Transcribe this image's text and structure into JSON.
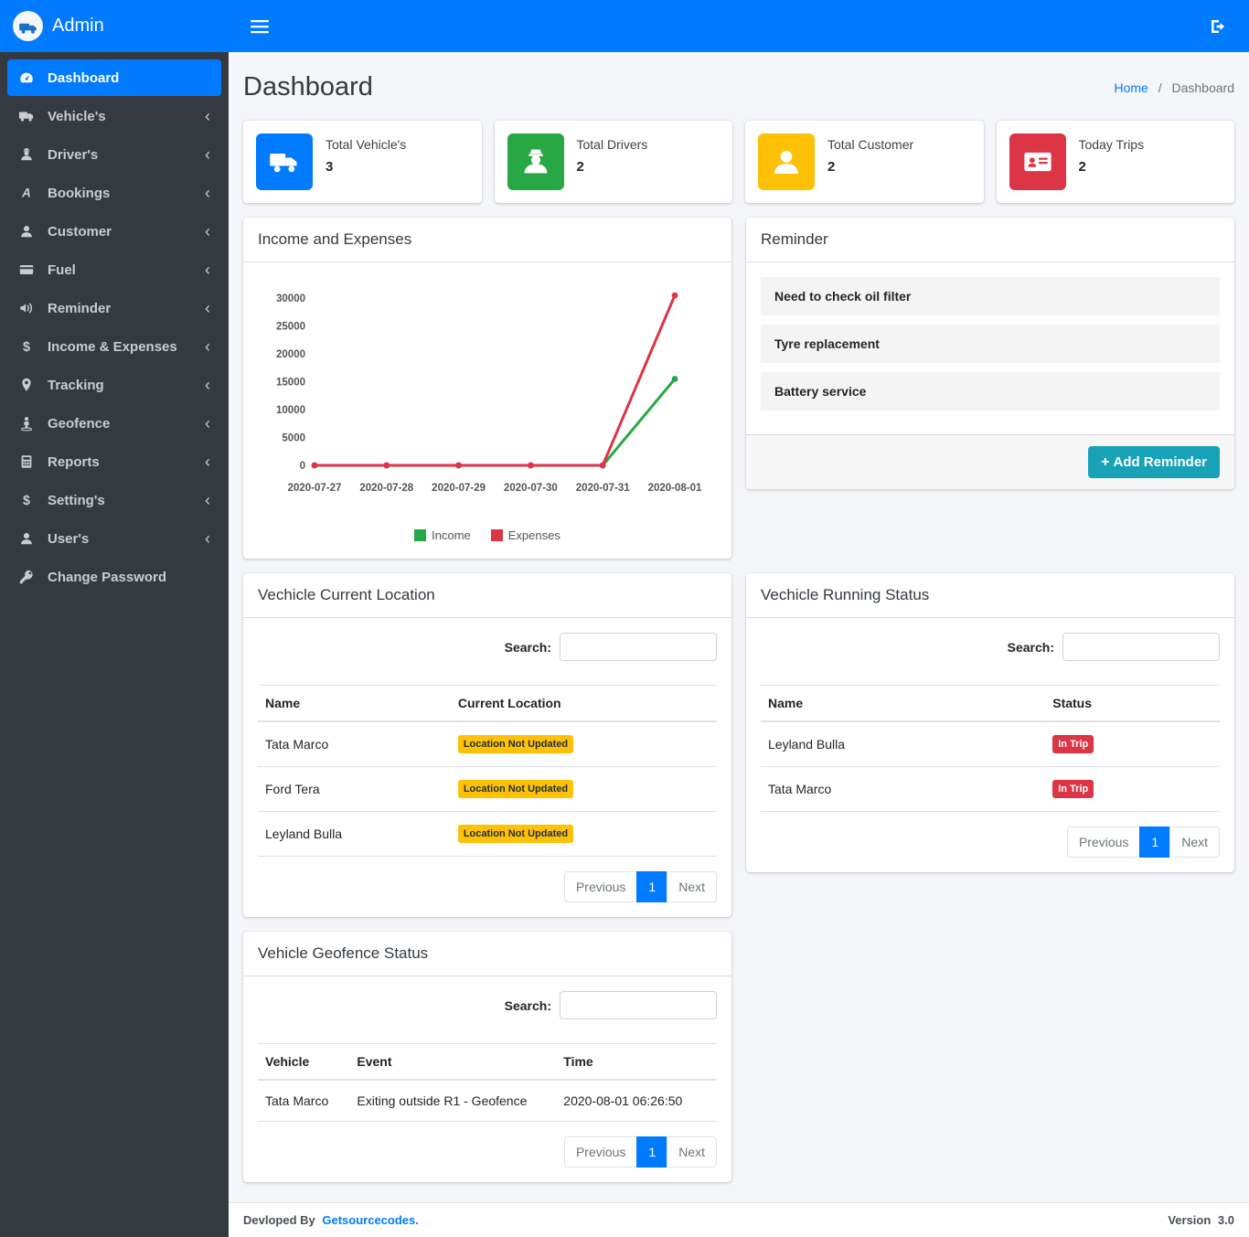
{
  "sidebar": {
    "brand": "Admin",
    "items": [
      {
        "label": "Dashboard",
        "icon": "tachometer-icon",
        "active": true,
        "chevron": false
      },
      {
        "label": "Vehicle's",
        "icon": "truck-icon",
        "active": false,
        "chevron": true
      },
      {
        "label": "Driver's",
        "icon": "driver-icon",
        "active": false,
        "chevron": true
      },
      {
        "label": "Bookings",
        "icon": "bookings-icon",
        "active": false,
        "chevron": true
      },
      {
        "label": "Customer",
        "icon": "user-icon",
        "active": false,
        "chevron": true
      },
      {
        "label": "Fuel",
        "icon": "fuel-card-icon",
        "active": false,
        "chevron": true
      },
      {
        "label": "Reminder",
        "icon": "bullhorn-icon",
        "active": false,
        "chevron": true
      },
      {
        "label": "Income & Expenses",
        "icon": "dollar-icon",
        "active": false,
        "chevron": true
      },
      {
        "label": "Tracking",
        "icon": "map-marker-icon",
        "active": false,
        "chevron": true
      },
      {
        "label": "Geofence",
        "icon": "street-view-icon",
        "active": false,
        "chevron": true
      },
      {
        "label": "Reports",
        "icon": "calculator-icon",
        "active": false,
        "chevron": true
      },
      {
        "label": "Setting's",
        "icon": "dollar-icon",
        "active": false,
        "chevron": true
      },
      {
        "label": "User's",
        "icon": "user-icon",
        "active": false,
        "chevron": true
      },
      {
        "label": "Change Password",
        "icon": "key-icon",
        "active": false,
        "chevron": false
      }
    ]
  },
  "page": {
    "title": "Dashboard",
    "breadcrumb_home": "Home",
    "breadcrumb_sep": "/",
    "breadcrumb_current": "Dashboard"
  },
  "stats": [
    {
      "label": "Total Vehicle's",
      "value": "3",
      "color": "#007bff",
      "icon": "truck-icon"
    },
    {
      "label": "Total Drivers",
      "value": "2",
      "color": "#28a745",
      "icon": "driver-icon"
    },
    {
      "label": "Total Customer",
      "value": "2",
      "color": "#ffc107",
      "icon": "user-icon"
    },
    {
      "label": "Today Trips",
      "value": "2",
      "color": "#dc3545",
      "icon": "id-card-icon"
    }
  ],
  "chart_card": {
    "title": "Income and Expenses"
  },
  "chart_data": {
    "type": "line",
    "x": [
      "2020-07-27",
      "2020-07-28",
      "2020-07-29",
      "2020-07-30",
      "2020-07-31",
      "2020-08-01"
    ],
    "series": [
      {
        "name": "Income",
        "color": "#28a745",
        "values": [
          0,
          0,
          0,
          0,
          0,
          15500
        ]
      },
      {
        "name": "Expenses",
        "color": "#dc3545",
        "values": [
          0,
          0,
          0,
          0,
          0,
          30500
        ]
      }
    ],
    "ylim": [
      0,
      30000
    ],
    "yticks": [
      0,
      5000,
      10000,
      15000,
      20000,
      25000,
      30000
    ],
    "legend_position": "bottom",
    "grid": false
  },
  "reminder": {
    "title": "Reminder",
    "items": [
      "Need to check oil filter",
      "Tyre replacement",
      "Battery service"
    ],
    "add_button": "Add Reminder",
    "add_button_color": "#17a2b8"
  },
  "current_location": {
    "title": "Vechicle Current Location",
    "search_label": "Search:",
    "search_value": "",
    "columns": [
      "Name",
      "Current Location"
    ],
    "rows": [
      {
        "name": "Tata Marco",
        "status": "Location Not Updated"
      },
      {
        "name": "Ford Tera",
        "status": "Location Not Updated"
      },
      {
        "name": "Leyland Bulla",
        "status": "Location Not Updated"
      }
    ],
    "pagination": {
      "prev": "Previous",
      "page": "1",
      "next": "Next"
    }
  },
  "running_status": {
    "title": "Vechicle Running Status",
    "search_label": "Search:",
    "search_value": "",
    "columns": [
      "Name",
      "Status"
    ],
    "rows": [
      {
        "name": "Leyland Bulla",
        "status": "In Trip"
      },
      {
        "name": "Tata Marco",
        "status": "In Trip"
      }
    ],
    "pagination": {
      "prev": "Previous",
      "page": "1",
      "next": "Next"
    }
  },
  "geofence_status": {
    "title": "Vehicle Geofence Status",
    "search_label": "Search:",
    "search_value": "",
    "columns": [
      "Vehicle",
      "Event",
      "Time"
    ],
    "rows": [
      {
        "vehicle": "Tata Marco",
        "event": "Exiting outside R1 - Geofence",
        "time": "2020-08-01 06:26:50"
      }
    ],
    "pagination": {
      "prev": "Previous",
      "page": "1",
      "next": "Next"
    }
  },
  "footer": {
    "left_bold": "Devloped By",
    "left_link": "Getsourcecodes.",
    "right_bold": "Version",
    "right_text": "3.0"
  },
  "colors": {
    "primary": "#007bff",
    "sidebar_bg": "#343a40",
    "success": "#28a745",
    "warning": "#ffc107",
    "danger": "#dc3545",
    "info": "#17a2b8",
    "content_bg": "#f4f6f9"
  }
}
